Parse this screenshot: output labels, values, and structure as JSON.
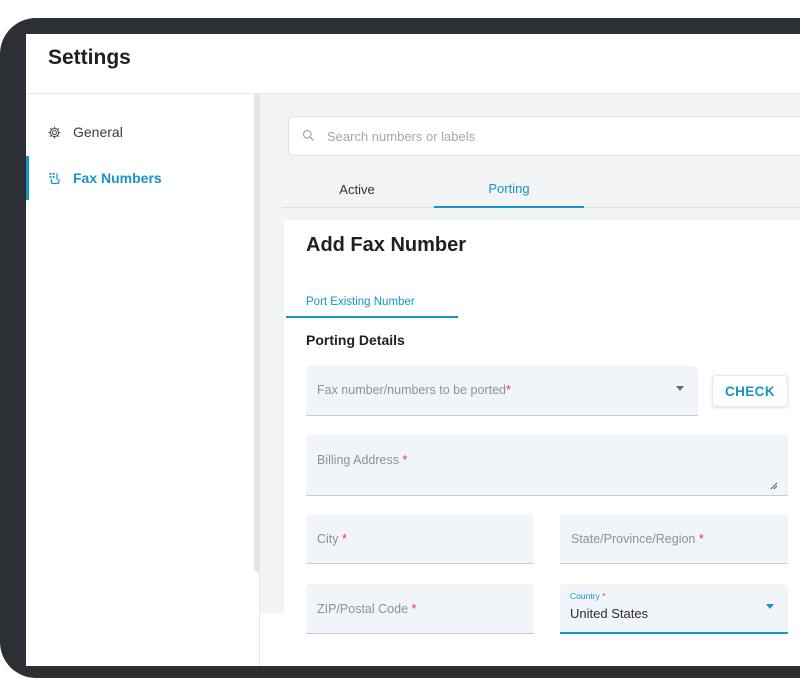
{
  "header": {
    "title": "Settings"
  },
  "sidebar": {
    "items": [
      {
        "label": "General",
        "icon": "gear-icon",
        "active": false
      },
      {
        "label": "Fax Numbers",
        "icon": "fax-numbers-icon",
        "active": true
      }
    ]
  },
  "search": {
    "placeholder": "Search numbers or labels",
    "value": ""
  },
  "tabs": [
    {
      "label": "Active",
      "active": false
    },
    {
      "label": "Porting",
      "active": true
    }
  ],
  "card": {
    "title": "Add Fax Number",
    "subtab": "Port Existing Number",
    "section_title": "Porting Details",
    "fields": {
      "fax_numbers": {
        "placeholder": "Fax number/numbers to be ported",
        "required_mark": "*"
      },
      "check_button": "CHECK",
      "billing_address": {
        "placeholder": "Billing Address",
        "required_mark": "*"
      },
      "city": {
        "placeholder": "City",
        "required_mark": "*"
      },
      "state": {
        "placeholder": "State/Province/Region",
        "required_mark": "*"
      },
      "zip": {
        "placeholder": "ZIP/Postal Code",
        "required_mark": "*"
      },
      "country": {
        "label": "Country",
        "required_mark": "*",
        "value": "United States"
      }
    }
  },
  "colors": {
    "accent": "#1596c9",
    "required": "#e53935",
    "frame": "#2c2f33"
  }
}
